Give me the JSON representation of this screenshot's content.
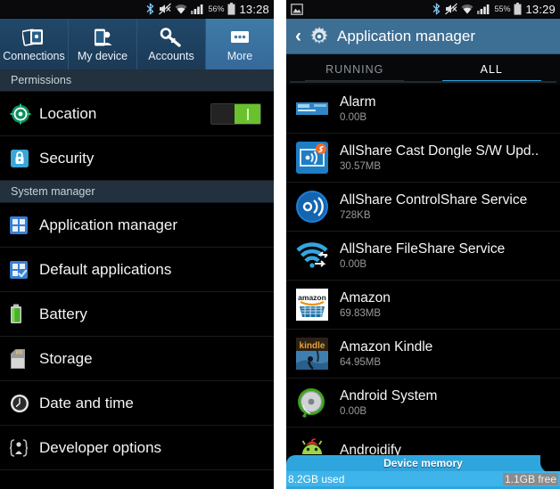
{
  "left": {
    "statusbar": {
      "icons": [
        "bluetooth-icon",
        "mute-icon",
        "wifi-icon",
        "signal-icon"
      ],
      "battery_percent": "56%",
      "time": "13:28"
    },
    "tabs": [
      {
        "label": "Connections",
        "icon": "connections-icon",
        "active": false
      },
      {
        "label": "My device",
        "icon": "my-device-icon",
        "active": false
      },
      {
        "label": "Accounts",
        "icon": "accounts-key-icon",
        "active": false
      },
      {
        "label": "More",
        "icon": "more-dots-icon",
        "active": true
      }
    ],
    "sections": [
      {
        "header": "Permissions"
      },
      {
        "header": "System manager"
      }
    ],
    "items": [
      {
        "label": "Location",
        "icon": "location-crosshair-icon",
        "toggle": "on"
      },
      {
        "label": "Security",
        "icon": "lock-shield-icon"
      },
      {
        "label": "Application manager",
        "icon": "grid-apps-icon"
      },
      {
        "label": "Default applications",
        "icon": "grid-check-icon"
      },
      {
        "label": "Battery",
        "icon": "battery-icon"
      },
      {
        "label": "Storage",
        "icon": "sdcard-icon"
      },
      {
        "label": "Date and time",
        "icon": "clock-icon"
      },
      {
        "label": "Developer options",
        "icon": "developer-icon"
      }
    ]
  },
  "right": {
    "statusbar": {
      "icons": [
        "screenshot-icon",
        "bluetooth-icon",
        "mute-icon",
        "wifi-icon",
        "signal-icon"
      ],
      "battery_percent": "55%",
      "time": "13:29"
    },
    "title": "Application manager",
    "back_icon": "back-chevron-icon",
    "gear_icon": "gear-icon",
    "tabs": [
      {
        "label": "RUNNING",
        "active": false
      },
      {
        "label": "ALL",
        "active": true
      }
    ],
    "apps": [
      {
        "name": "Alarm",
        "size": "0.00B",
        "icon": "alarm-icon"
      },
      {
        "name": "AllShare Cast Dongle S/W Upd..",
        "size": "30.57MB",
        "icon": "allshare-cast-icon"
      },
      {
        "name": "AllShare ControlShare Service",
        "size": "728KB",
        "icon": "allshare-control-icon"
      },
      {
        "name": "AllShare FileShare Service",
        "size": "0.00B",
        "icon": "allshare-fileshare-icon"
      },
      {
        "name": "Amazon",
        "size": "69.83MB",
        "icon": "amazon-icon"
      },
      {
        "name": "Amazon Kindle",
        "size": "64.95MB",
        "icon": "kindle-icon"
      },
      {
        "name": "Android System",
        "size": "0.00B",
        "icon": "android-system-icon"
      },
      {
        "name": "Androidify",
        "size": "",
        "icon": "androidify-icon"
      }
    ],
    "memory": {
      "title": "Device memory",
      "used": "8.2GB used",
      "free": "1.1GB free",
      "accent": "#2fa5de"
    }
  },
  "colors": {
    "tab_active": "#3f7ba6",
    "titlebar": "#3d6e93",
    "tab_underline": "#2fa3e0",
    "toggle_on": "#69c22d",
    "section_bg": "#22313d"
  }
}
